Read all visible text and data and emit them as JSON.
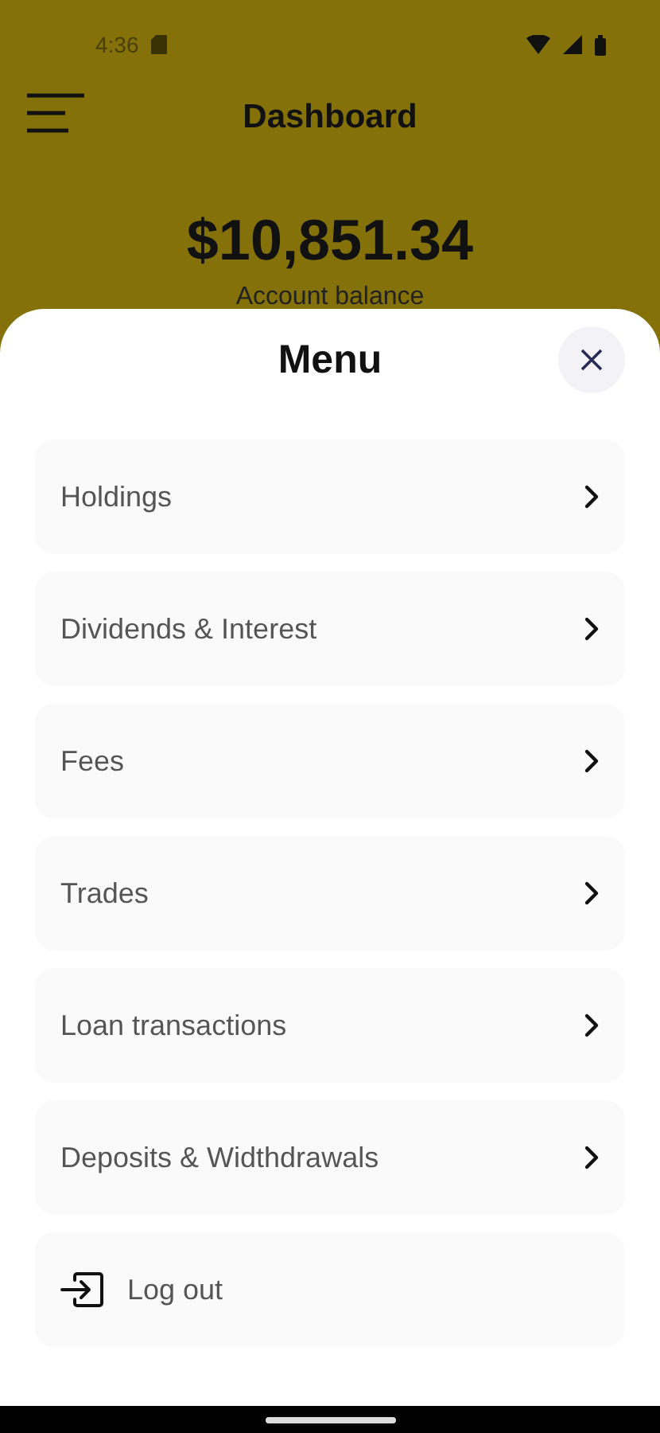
{
  "status_bar": {
    "time": "4:36"
  },
  "header": {
    "title": "Dashboard"
  },
  "balance": {
    "amount": "$10,851.34",
    "label": "Account balance"
  },
  "menu": {
    "title": "Menu",
    "items": [
      {
        "kind": "link",
        "label": "Holdings"
      },
      {
        "kind": "link",
        "label": "Dividends & Interest"
      },
      {
        "kind": "link",
        "label": "Fees"
      },
      {
        "kind": "link",
        "label": "Trades"
      },
      {
        "kind": "link",
        "label": "Loan transactions"
      },
      {
        "kind": "link",
        "label": "Deposits & Widthdrawals"
      },
      {
        "kind": "logout",
        "label": "Log out"
      }
    ]
  }
}
